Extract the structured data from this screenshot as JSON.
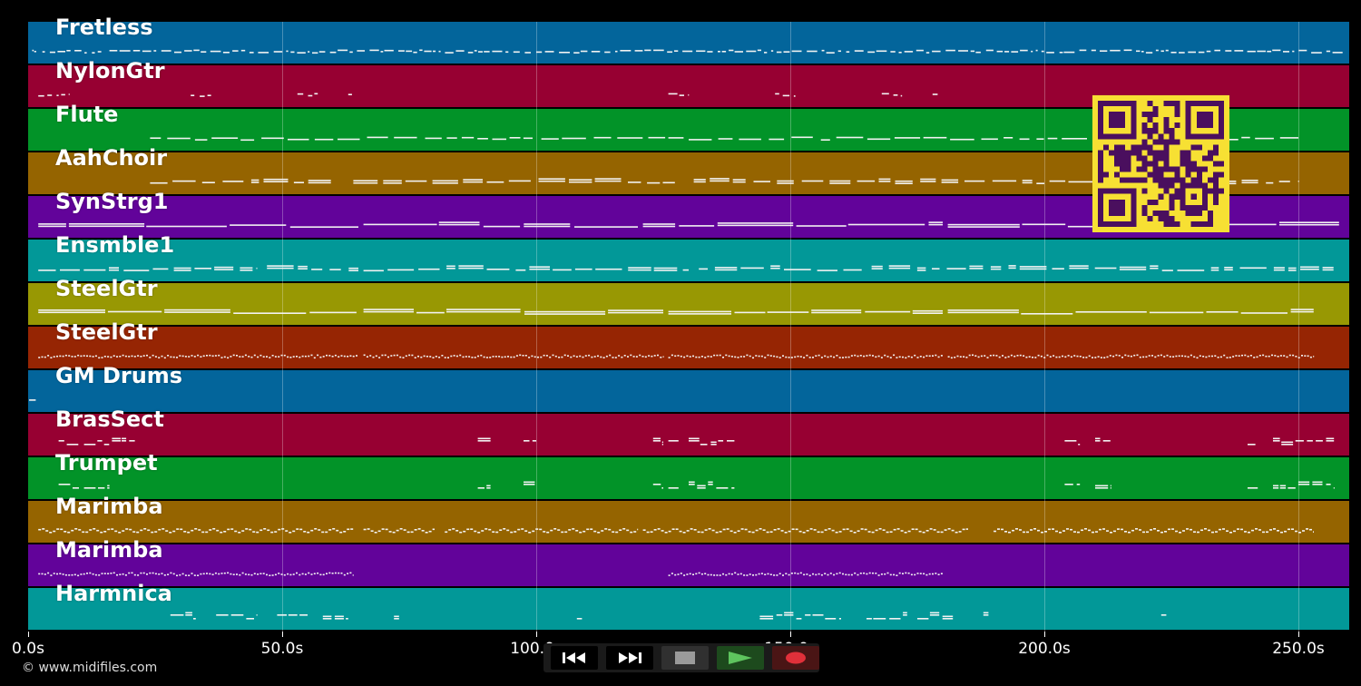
{
  "tracks": [
    {
      "name": "Fretless",
      "color": "#03659b",
      "notes": [
        [
          0.8,
          1.1
        ],
        [
          1.2,
          1.6
        ],
        [
          2.8,
          14.5
        ],
        [
          16,
          99
        ],
        [
          100,
          160
        ],
        [
          161,
          259
        ]
      ],
      "style": "sparse"
    },
    {
      "name": "NylonGtr",
      "color": "#970032",
      "notes": [
        [
          2,
          6
        ],
        [
          6.5,
          8
        ],
        [
          32,
          36
        ],
        [
          53,
          57
        ],
        [
          63,
          64
        ],
        [
          126,
          130
        ],
        [
          147,
          151
        ],
        [
          168,
          172
        ],
        [
          178,
          179
        ]
      ],
      "style": "short"
    },
    {
      "name": "Flute",
      "color": "#029328",
      "notes": [
        [
          24,
          100
        ],
        [
          101,
          129
        ],
        [
          130,
          250
        ]
      ],
      "style": "dash"
    },
    {
      "name": "AahChoir",
      "color": "#956400",
      "notes": [
        [
          24,
          60
        ],
        [
          64,
          128
        ],
        [
          131,
          200
        ],
        [
          201,
          250
        ]
      ],
      "style": "dashdouble"
    },
    {
      "name": "SynStrg1",
      "color": "#62039a",
      "notes": [
        [
          2,
          65
        ],
        [
          66,
          120
        ],
        [
          121,
          180
        ],
        [
          181,
          258
        ]
      ],
      "style": "long"
    },
    {
      "name": "Ensmble1",
      "color": "#029898",
      "notes": [
        [
          2,
          45
        ],
        [
          47,
          65
        ],
        [
          66,
          130
        ],
        [
          132,
          165
        ],
        [
          166,
          258
        ]
      ],
      "style": "dashdouble"
    },
    {
      "name": "SteelGtr",
      "color": "#989803",
      "notes": [
        [
          2,
          65
        ],
        [
          66,
          125
        ],
        [
          126,
          180
        ],
        [
          181,
          253
        ]
      ],
      "style": "long"
    },
    {
      "name": "SteelGtr",
      "color": "#962503",
      "notes": [
        [
          2,
          65
        ],
        [
          66,
          125
        ],
        [
          126,
          180
        ],
        [
          181,
          253
        ]
      ],
      "style": "dotted"
    },
    {
      "name": "GM Drums",
      "color": "#03659b",
      "notes": [
        [
          0.2,
          1.5
        ]
      ],
      "style": "short"
    },
    {
      "name": "BrasSect",
      "color": "#970032",
      "notes": [
        [
          6,
          10
        ],
        [
          11,
          16
        ],
        [
          16.5,
          21
        ],
        [
          88.5,
          91
        ],
        [
          97.5,
          100
        ],
        [
          123,
          125
        ],
        [
          126,
          128
        ],
        [
          130,
          139
        ],
        [
          204,
          207
        ],
        [
          210,
          213
        ],
        [
          240,
          242
        ],
        [
          245,
          257
        ]
      ],
      "style": "stack"
    },
    {
      "name": "Trumpet",
      "color": "#029328",
      "notes": [
        [
          6,
          10
        ],
        [
          11,
          16
        ],
        [
          88.5,
          91
        ],
        [
          97.5,
          100
        ],
        [
          123,
          125
        ],
        [
          126,
          128
        ],
        [
          130,
          139
        ],
        [
          204,
          207
        ],
        [
          210,
          213
        ],
        [
          240,
          242
        ],
        [
          245,
          257
        ]
      ],
      "style": "stack"
    },
    {
      "name": "Marimba",
      "color": "#956400",
      "notes": [
        [
          2,
          64
        ],
        [
          66,
          80
        ],
        [
          82,
          120
        ],
        [
          121,
          185
        ],
        [
          190,
          253
        ]
      ],
      "style": "zig"
    },
    {
      "name": "Marimba",
      "color": "#62039a",
      "notes": [
        [
          2,
          64
        ],
        [
          126,
          180
        ]
      ],
      "style": "dotted"
    },
    {
      "name": "Harmnica",
      "color": "#029898",
      "notes": [
        [
          28,
          33
        ],
        [
          37,
          45
        ],
        [
          49,
          55
        ],
        [
          58,
          63
        ],
        [
          72,
          73
        ],
        [
          108,
          109
        ],
        [
          144,
          160
        ],
        [
          165,
          173
        ],
        [
          175,
          182
        ],
        [
          188,
          189
        ],
        [
          223,
          224
        ]
      ],
      "style": "stack"
    }
  ],
  "axis": {
    "xmin": 0,
    "xmax": 260,
    "ticks": [
      0,
      50,
      100,
      150,
      200,
      250
    ],
    "tick_labels": [
      "0.0s",
      "50.0s",
      "100.0s",
      "150.0s",
      "200.0s",
      "250.0s"
    ]
  },
  "copyright": "© www.midifiles.com",
  "transport": {
    "rewind": "rewind-icon",
    "fastforward": "fast-forward-icon",
    "stop": "stop-icon",
    "play": "play-icon",
    "record": "record-icon"
  }
}
